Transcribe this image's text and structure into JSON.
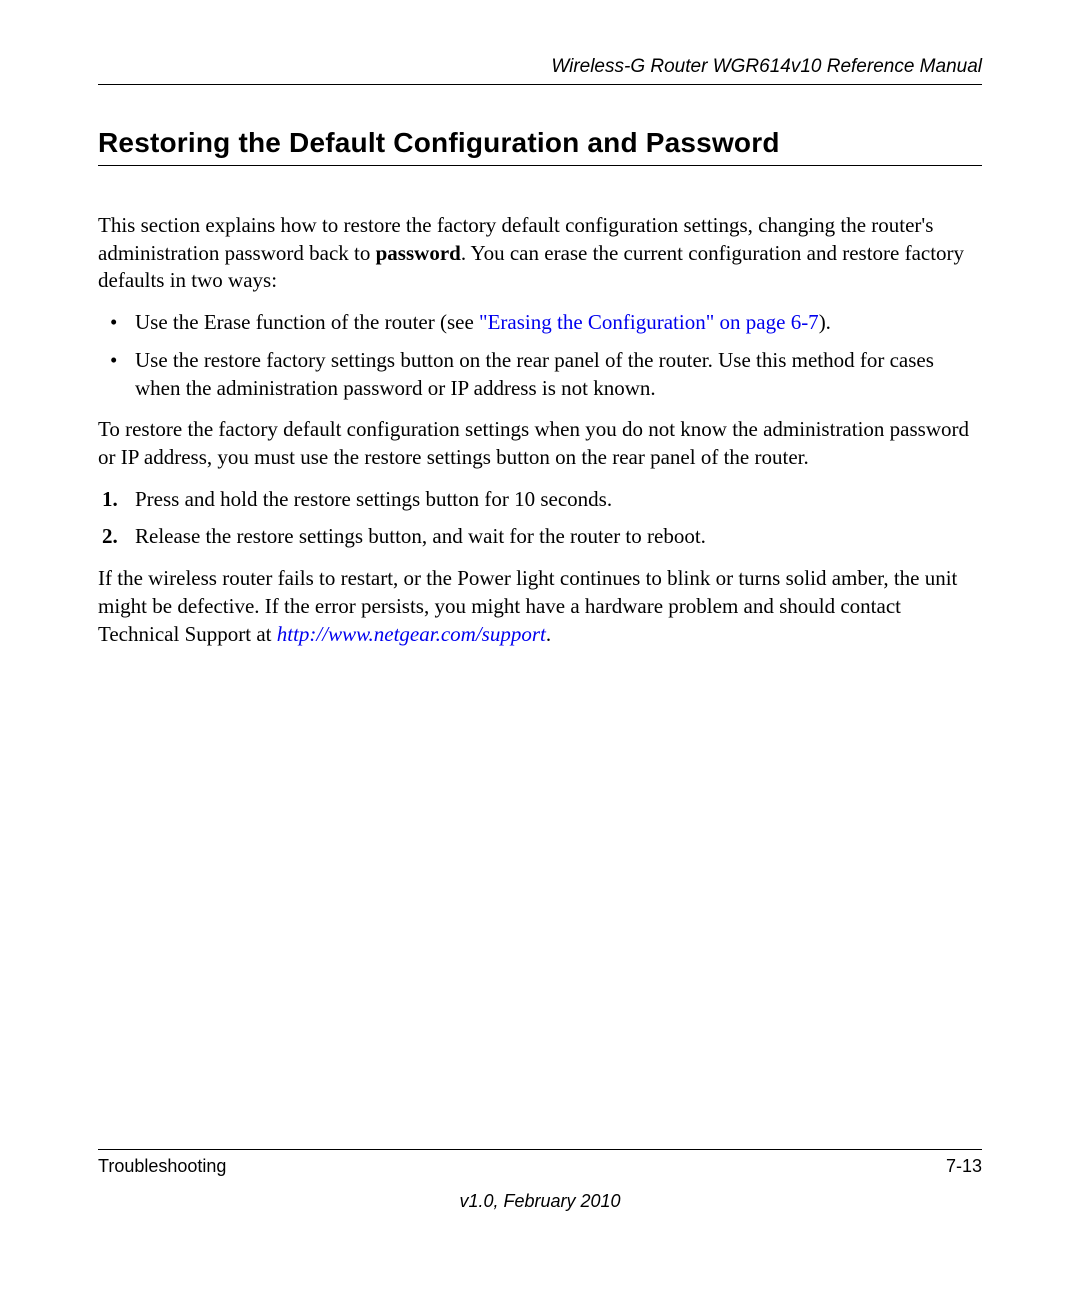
{
  "header": {
    "title": "Wireless-G Router WGR614v10 Reference Manual"
  },
  "section_heading": "Restoring the Default Configuration and Password",
  "intro": {
    "part1": "This section explains how to restore the factory default configuration settings, changing the router's administration password back to ",
    "bold": "password",
    "part2": ". You can erase the current configuration and restore factory defaults in two ways:"
  },
  "bullets": [
    {
      "pre": "Use the Erase function of the router (see ",
      "link": "\"Erasing the Configuration\" on page 6-7",
      "post": ")."
    },
    {
      "text": "Use the restore factory settings button on the rear panel of the router. Use this method for cases when the administration password or IP address is not known."
    }
  ],
  "mid_para": "To restore the factory default configuration settings when you do not know the administration password or IP address, you must use the restore settings button on the rear panel of the router.",
  "steps": [
    "Press and hold the restore settings button for 10 seconds.",
    "Release the restore settings button, and wait for the router to reboot."
  ],
  "closing": {
    "part1": "If the wireless router fails to restart, or the Power light continues to blink or turns solid amber, the unit might be defective. If the error persists, you might have a hardware problem and should contact Technical Support at ",
    "link": "http://www.netgear.com/support",
    "part2": "."
  },
  "footer": {
    "left": "Troubleshooting",
    "right": "7-13",
    "center": "v1.0, February 2010"
  }
}
